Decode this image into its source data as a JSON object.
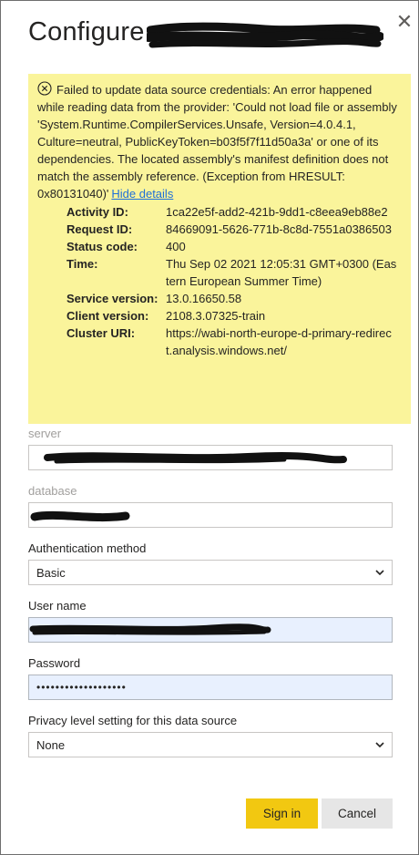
{
  "dialog": {
    "title": "Configure",
    "close_glyph": "✕",
    "close_icon": "close-icon"
  },
  "error": {
    "icon": "error-circle-x-icon",
    "message": "Failed to update data source credentials: An error happened while reading data from the provider: 'Could not load file or assembly 'System.Runtime.CompilerServices.Unsafe, Version=4.0.4.1, Culture=neutral, PublicKeyToken=b03f5f7f11d50a3a' or one of its dependencies. The located assembly's manifest definition does not match the assembly reference. (Exception from HRESULT: 0x80131040)'",
    "link_label": "Hide details",
    "details": [
      {
        "label": "Activity ID:",
        "value": "1ca22e5f-add2-421b-9dd1-c8eea9eb88e2"
      },
      {
        "label": "Request ID:",
        "value": "84669091-5626-771b-8c8d-7551a0386503"
      },
      {
        "label": "Status code:",
        "value": "400"
      },
      {
        "label": "Time:",
        "value": "Thu Sep 02 2021 12:05:31 GMT+0300 (Eastern European Summer Time)"
      },
      {
        "label": "Service version:",
        "value": "13.0.16650.58"
      },
      {
        "label": "Client version:",
        "value": "2108.3.07325-train"
      },
      {
        "label": "Cluster URI:",
        "value": "https://wabi-north-europe-d-primary-redirect.analysis.windows.net/"
      }
    ],
    "background_color": "#faf49b"
  },
  "form": {
    "server_label": "server",
    "database_label": "database",
    "auth_label": "Authentication method",
    "auth_value": "Basic",
    "username_label": "User name",
    "password_label": "Password",
    "password_value": "•••••••••••••••••••",
    "privacy_label": "Privacy level setting for this data source",
    "privacy_value": "None"
  },
  "buttons": {
    "signin_label": "Sign in",
    "cancel_label": "Cancel",
    "primary_color": "#f2c811"
  }
}
